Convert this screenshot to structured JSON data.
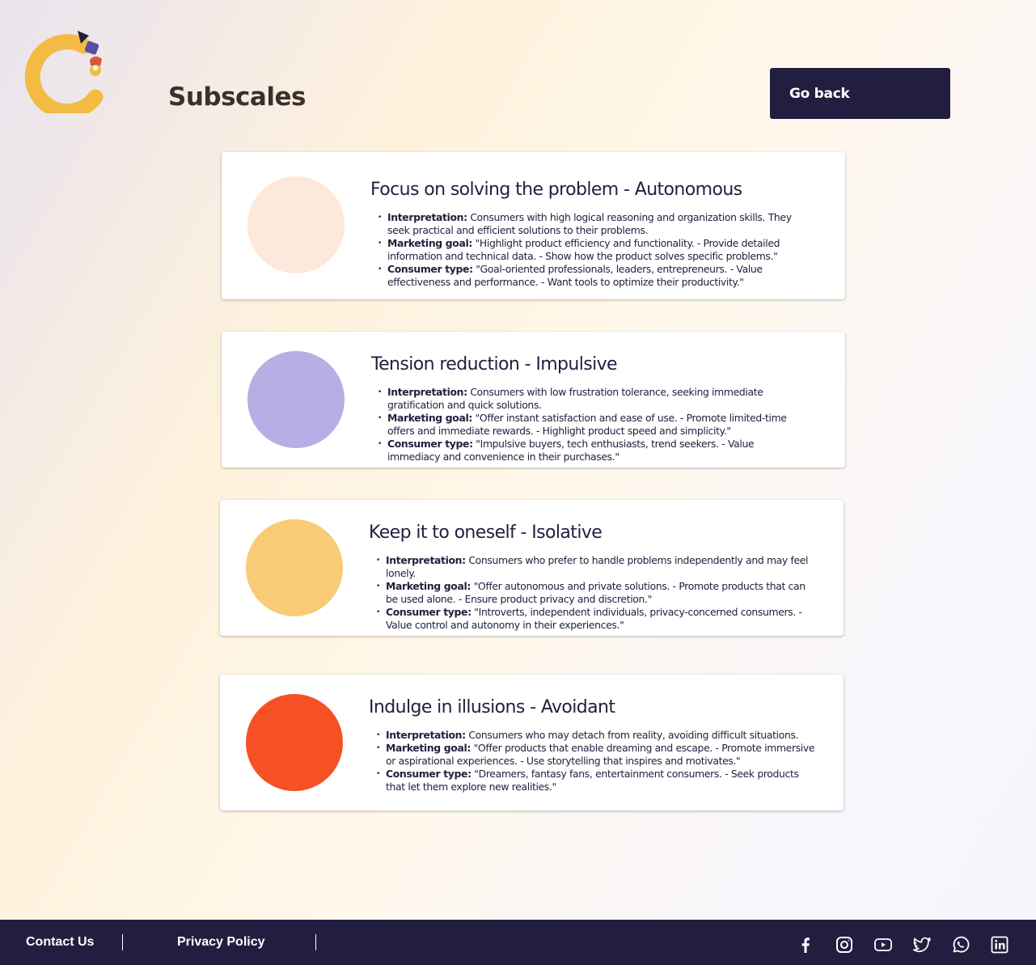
{
  "header": {
    "title": "Subscales",
    "go_back_label": "Go back",
    "logo": "brand-logo"
  },
  "cards": [
    {
      "title": "Focus on solving the problem - Autonomous",
      "color": "#fde8dc",
      "items": [
        {
          "label": "Interpretation:",
          "text": " Consumers with high logical reasoning and organization skills. They seek practical and efficient solutions to their problems."
        },
        {
          "label": "Marketing goal:",
          "text": " \"Highlight product efficiency and functionality. - Provide detailed information and technical data. - Show how the product solves specific problems.\""
        },
        {
          "label": "Consumer type:",
          "text": " \"Goal-oriented professionals, leaders, entrepreneurs. - Value effectiveness and performance. - Want tools to optimize their productivity.\""
        }
      ]
    },
    {
      "title": "Tension reduction - Impulsive",
      "color": "#b7aee5",
      "items": [
        {
          "label": "Interpretation:",
          "text": " Consumers with low frustration tolerance, seeking immediate gratification and quick solutions."
        },
        {
          "label": "Marketing goal:",
          "text": " \"Offer instant satisfaction and ease of use. - Promote limited-time offers and immediate rewards. - Highlight product speed and simplicity.\""
        },
        {
          "label": "Consumer type:",
          "text": " \"Impulsive buyers, tech enthusiasts, trend seekers. - Value immediacy and convenience in their purchases.\""
        }
      ]
    },
    {
      "title": "Keep it to oneself - Isolative",
      "color": "#f9cb76",
      "items": [
        {
          "label": "Interpretation:",
          "text": " Consumers who prefer to handle problems independently and may feel lonely."
        },
        {
          "label": "Marketing goal:",
          "text": " \"Offer autonomous and private solutions. - Promote products that can be used alone. - Ensure product privacy and discretion.\""
        },
        {
          "label": "Consumer type:",
          "text": " \"Introverts, independent individuals, privacy-concerned consumers. - Value control and autonomy in their experiences.\""
        }
      ]
    },
    {
      "title": "Indulge in illusions - Avoidant",
      "color": "#f65025",
      "items": [
        {
          "label": "Interpretation:",
          "text": " Consumers who may detach from reality, avoiding difficult situations."
        },
        {
          "label": "Marketing goal:",
          "text": " \"Offer products that enable dreaming and escape. - Promote immersive or aspirational experiences. - Use storytelling that inspires and motivates.\""
        },
        {
          "label": "Consumer type:",
          "text": " \"Dreamers, fantasy fans, entertainment consumers. - Seek products that let them explore new realities.\""
        }
      ]
    }
  ],
  "footer": {
    "contact_label": "Contact Us",
    "privacy_label": "Privacy Policy",
    "social": [
      "facebook-icon",
      "instagram-icon",
      "youtube-icon",
      "twitter-icon",
      "whatsapp-icon",
      "linkedin-icon"
    ]
  },
  "colors": {
    "primary_dark": "#221e3f",
    "brand_yellow": "#f3bb43",
    "title_brown": "#3d2f2b"
  }
}
